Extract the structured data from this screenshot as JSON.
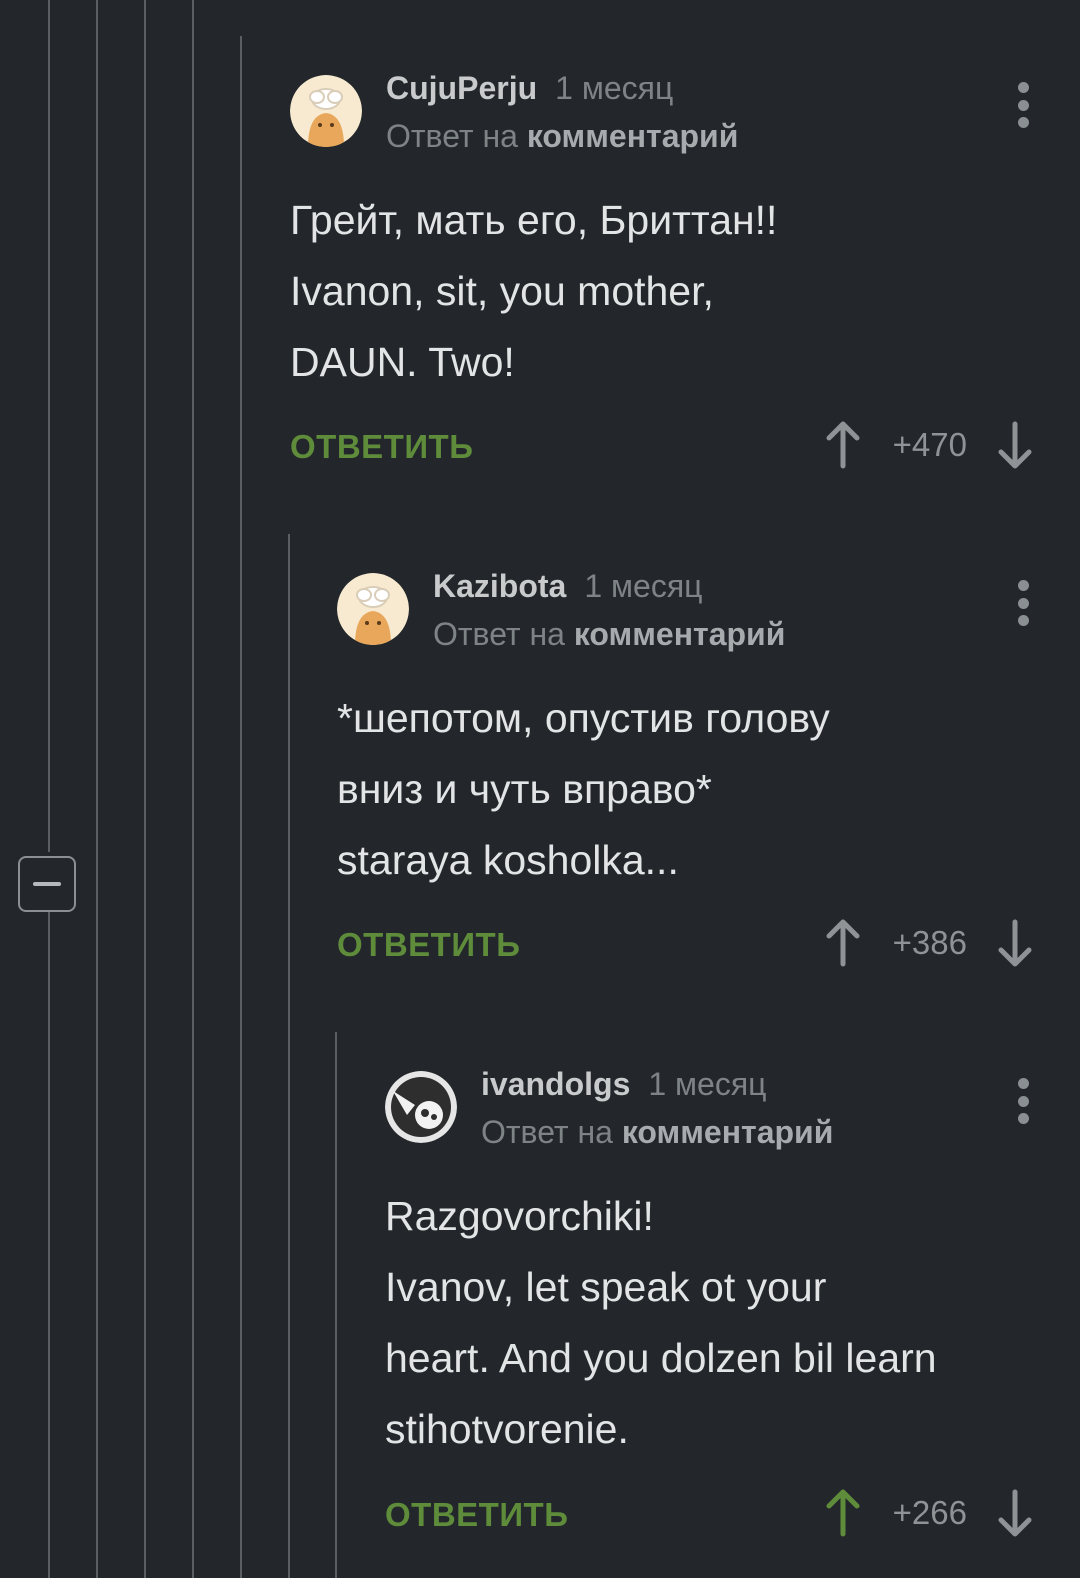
{
  "comments": [
    {
      "username": "CujuPerju",
      "time": "1 месяц",
      "reply_prefix": "Ответ на",
      "reply_target": "комментарий",
      "text": "Грейт, мать его, Бриттан!!\nIvanon, sit, you mother,\nDAUN. Two!",
      "reply_label": "ОТВЕТИТЬ",
      "score": "+470",
      "avatar_icon": "chef-avatar-icon",
      "upvoted": false
    },
    {
      "username": "Kazibota",
      "time": "1 месяц",
      "reply_prefix": "Ответ на",
      "reply_target": "комментарий",
      "text": "*шепотом, опустив голову\nвниз и чуть вправо*\nstaraya kosholka...",
      "reply_label": "ОТВЕТИТЬ",
      "score": "+386",
      "avatar_icon": "chef-avatar-icon",
      "upvoted": false
    },
    {
      "username": "ivandolgs",
      "time": "1 месяц",
      "reply_prefix": "Ответ на",
      "reply_target": "комментарий",
      "text": "Razgovorchiki!\nIvanov, let speak ot your\nheart. And you dolzen bil learn\nstihotvorenie.",
      "reply_label": "ОТВЕТИТЬ",
      "score": "+266",
      "avatar_icon": "ball-avatar-icon",
      "upvoted": true
    }
  ],
  "colors": {
    "background": "#23272b",
    "accent_green": "#5e8c3a",
    "upvote_active": "#5e8c3a",
    "vote_inactive": "#8f9396"
  }
}
